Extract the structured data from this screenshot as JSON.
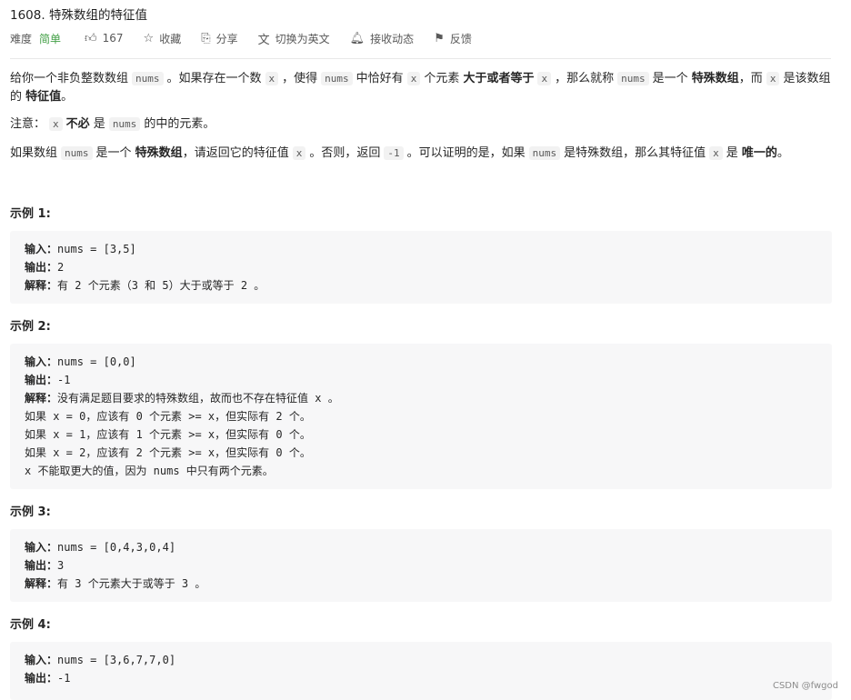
{
  "problem": {
    "title": "1608. 特殊数组的特征值",
    "difficulty_label": "难度",
    "difficulty_value": "简单",
    "likes": "167",
    "favorite_label": "收藏",
    "share_label": "分享",
    "switch_lang_label": "切换为英文",
    "subscribe_label": "接收动态",
    "feedback_label": "反馈"
  },
  "description": {
    "p1": {
      "t1": "给你一个非负整数数组",
      "c1": "nums",
      "t2": "。如果存在一个数",
      "c2": "x",
      "t3": "，使得",
      "c3": "nums",
      "t4": "中恰好有",
      "c4": "x",
      "t5": "个元素",
      "b1": "大于或者等于",
      "c5": "x",
      "t6": "，那么就称",
      "c6": "nums",
      "t7": "是一个",
      "b2": "特殊数组",
      "t8": "，而",
      "c7": "x",
      "t9": "是该数组的",
      "b3": "特征值",
      "t10": "。"
    },
    "p2": {
      "t1": "注意：",
      "c1": "x",
      "b1": "不必",
      "t2": "是",
      "c2": "nums",
      "t3": "的中的元素。"
    },
    "p3": {
      "t1": "如果数组",
      "c1": "nums",
      "t2": "是一个",
      "b1": "特殊数组",
      "t3": "，请返回它的特征值",
      "c2": "x",
      "t4": "。否则，返回",
      "c3": "-1",
      "t5": "。可以证明的是，如果",
      "c4": "nums",
      "t6": "是特殊数组，那么其特征值",
      "c5": "x",
      "t7": "是",
      "b2": "唯一的",
      "t8": "。"
    }
  },
  "examples": [
    {
      "title": "示例 1:",
      "input_label": "输入：",
      "input": "nums = [3,5]",
      "output_label": "输出：",
      "output": "2",
      "explain_label": "解释：",
      "explain": "有 2 个元素（3 和 5）大于或等于 2 。",
      "extra": []
    },
    {
      "title": "示例 2:",
      "input_label": "输入：",
      "input": "nums = [0,0]",
      "output_label": "输出：",
      "output": "-1",
      "explain_label": "解释：",
      "explain": "没有满足题目要求的特殊数组，故而也不存在特征值 x 。",
      "extra": [
        "如果 x = 0，应该有 0 个元素 >= x，但实际有 2 个。",
        "如果 x = 1，应该有 1 个元素 >= x，但实际有 0 个。",
        "如果 x = 2，应该有 2 个元素 >= x，但实际有 0 个。",
        "x 不能取更大的值，因为 nums 中只有两个元素。"
      ]
    },
    {
      "title": "示例 3:",
      "input_label": "输入：",
      "input": "nums = [0,4,3,0,4]",
      "output_label": "输出：",
      "output": "3",
      "explain_label": "解释：",
      "explain": "有 3 个元素大于或等于 3 。",
      "extra": []
    },
    {
      "title": "示例 4:",
      "input_label": "输入：",
      "input": "nums = [3,6,7,7,0]",
      "output_label": "输出：",
      "output": "-1",
      "explain_label": "",
      "explain": "",
      "extra": []
    }
  ],
  "watermark": "CSDN @fwgod",
  "colors": {
    "difficulty_easy": "#43a047",
    "code_bg": "#f2f2f2",
    "example_bg": "#f7f7f8"
  },
  "icons": {
    "like": "thumbs-up-icon",
    "favorite": "star-icon",
    "share": "share-icon",
    "translate": "translate-icon",
    "subscribe": "bell-icon",
    "feedback": "flag-icon"
  }
}
